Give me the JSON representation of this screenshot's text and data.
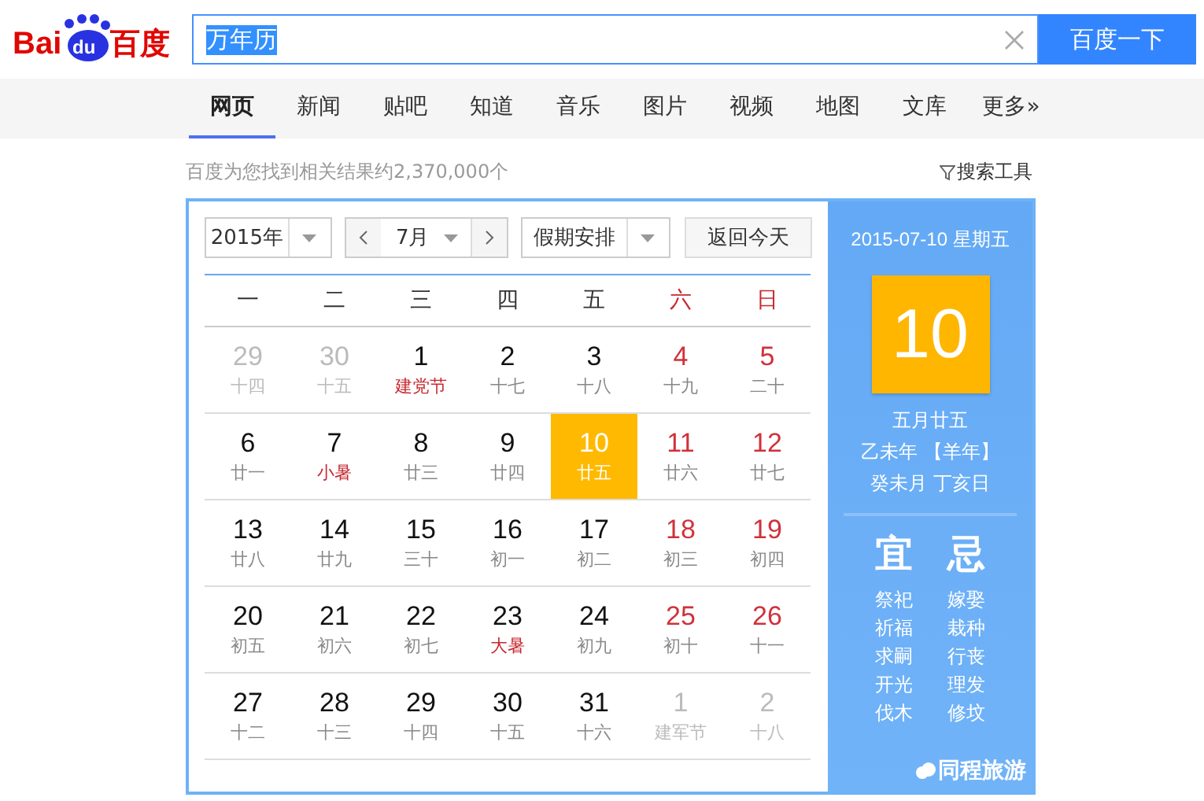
{
  "logo": {
    "left": "Bai",
    "paw": "du",
    "right": "百度"
  },
  "search": {
    "query": "万年历",
    "button": "百度一下"
  },
  "nav": [
    {
      "label": "网页",
      "selected": true
    },
    {
      "label": "新闻",
      "selected": false
    },
    {
      "label": "贴吧",
      "selected": false
    },
    {
      "label": "知道",
      "selected": false
    },
    {
      "label": "音乐",
      "selected": false
    },
    {
      "label": "图片",
      "selected": false
    },
    {
      "label": "视频",
      "selected": false
    },
    {
      "label": "地图",
      "selected": false
    },
    {
      "label": "文库",
      "selected": false
    },
    {
      "label": "更多»",
      "selected": false
    }
  ],
  "result_count": "百度为您找到相关结果约2,370,000个",
  "search_tools": "搜索工具",
  "calendar": {
    "year": "2015年",
    "month": "7月",
    "holiday_select": "假期安排",
    "today_button": "返回今天",
    "weekdays": [
      {
        "label": "一",
        "weekend": false
      },
      {
        "label": "二",
        "weekend": false
      },
      {
        "label": "三",
        "weekend": false
      },
      {
        "label": "四",
        "weekend": false
      },
      {
        "label": "五",
        "weekend": false
      },
      {
        "label": "六",
        "weekend": true
      },
      {
        "label": "日",
        "weekend": true
      }
    ],
    "weeks": [
      [
        {
          "day": "29",
          "lunar": "十四",
          "kind": "muted",
          "festival": false,
          "selected": false
        },
        {
          "day": "30",
          "lunar": "十五",
          "kind": "muted",
          "festival": false,
          "selected": false
        },
        {
          "day": "1",
          "lunar": "建党节",
          "kind": "normal",
          "festival": true,
          "selected": false
        },
        {
          "day": "2",
          "lunar": "十七",
          "kind": "normal",
          "festival": false,
          "selected": false
        },
        {
          "day": "3",
          "lunar": "十八",
          "kind": "normal",
          "festival": false,
          "selected": false
        },
        {
          "day": "4",
          "lunar": "十九",
          "kind": "weekend",
          "festival": false,
          "selected": false
        },
        {
          "day": "5",
          "lunar": "二十",
          "kind": "weekend",
          "festival": false,
          "selected": false
        }
      ],
      [
        {
          "day": "6",
          "lunar": "廿一",
          "kind": "normal",
          "festival": false,
          "selected": false
        },
        {
          "day": "7",
          "lunar": "小暑",
          "kind": "normal",
          "festival": true,
          "selected": false
        },
        {
          "day": "8",
          "lunar": "廿三",
          "kind": "normal",
          "festival": false,
          "selected": false
        },
        {
          "day": "9",
          "lunar": "廿四",
          "kind": "normal",
          "festival": false,
          "selected": false
        },
        {
          "day": "10",
          "lunar": "廿五",
          "selected": true
        },
        {
          "day": "11",
          "lunar": "廿六",
          "kind": "weekend",
          "festival": false,
          "selected": false
        },
        {
          "day": "12",
          "lunar": "廿七",
          "kind": "weekend",
          "festival": false,
          "selected": false
        }
      ],
      [
        {
          "day": "13",
          "lunar": "廿八",
          "kind": "normal",
          "festival": false,
          "selected": false
        },
        {
          "day": "14",
          "lunar": "廿九",
          "kind": "normal",
          "festival": false,
          "selected": false
        },
        {
          "day": "15",
          "lunar": "三十",
          "kind": "normal",
          "festival": false,
          "selected": false
        },
        {
          "day": "16",
          "lunar": "初一",
          "kind": "normal",
          "festival": false,
          "selected": false
        },
        {
          "day": "17",
          "lunar": "初二",
          "kind": "normal",
          "festival": false,
          "selected": false
        },
        {
          "day": "18",
          "lunar": "初三",
          "kind": "weekend",
          "festival": false,
          "selected": false
        },
        {
          "day": "19",
          "lunar": "初四",
          "kind": "weekend",
          "festival": false,
          "selected": false
        }
      ],
      [
        {
          "day": "20",
          "lunar": "初五",
          "kind": "normal",
          "festival": false,
          "selected": false
        },
        {
          "day": "21",
          "lunar": "初六",
          "kind": "normal",
          "festival": false,
          "selected": false
        },
        {
          "day": "22",
          "lunar": "初七",
          "kind": "normal",
          "festival": false,
          "selected": false
        },
        {
          "day": "23",
          "lunar": "大暑",
          "kind": "normal",
          "festival": true,
          "selected": false
        },
        {
          "day": "24",
          "lunar": "初九",
          "kind": "normal",
          "festival": false,
          "selected": false
        },
        {
          "day": "25",
          "lunar": "初十",
          "kind": "weekend",
          "festival": false,
          "selected": false
        },
        {
          "day": "26",
          "lunar": "十一",
          "kind": "weekend",
          "festival": false,
          "selected": false
        }
      ],
      [
        {
          "day": "27",
          "lunar": "十二",
          "kind": "normal",
          "festival": false,
          "selected": false
        },
        {
          "day": "28",
          "lunar": "十三",
          "kind": "normal",
          "festival": false,
          "selected": false
        },
        {
          "day": "29",
          "lunar": "十四",
          "kind": "normal",
          "festival": false,
          "selected": false
        },
        {
          "day": "30",
          "lunar": "十五",
          "kind": "normal",
          "festival": false,
          "selected": false
        },
        {
          "day": "31",
          "lunar": "十六",
          "kind": "normal",
          "festival": false,
          "selected": false
        },
        {
          "day": "1",
          "lunar": "建军节",
          "kind": "muted",
          "festival": false,
          "selected": false
        },
        {
          "day": "2",
          "lunar": "十八",
          "kind": "muted",
          "festival": false,
          "selected": false
        }
      ]
    ]
  },
  "detail": {
    "date": "2015-07-10 星期五",
    "day": "10",
    "lunar_lines": [
      "五月廿五",
      "乙未年 【羊年】",
      "癸未月 丁亥日"
    ],
    "good_title": "宜",
    "bad_title": "忌",
    "good": [
      "祭祀",
      "祈福",
      "求嗣",
      "开光",
      "伐木"
    ],
    "bad": [
      "嫁娶",
      "栽种",
      "行丧",
      "理发",
      "修坟"
    ],
    "brand": "同程旅游"
  }
}
